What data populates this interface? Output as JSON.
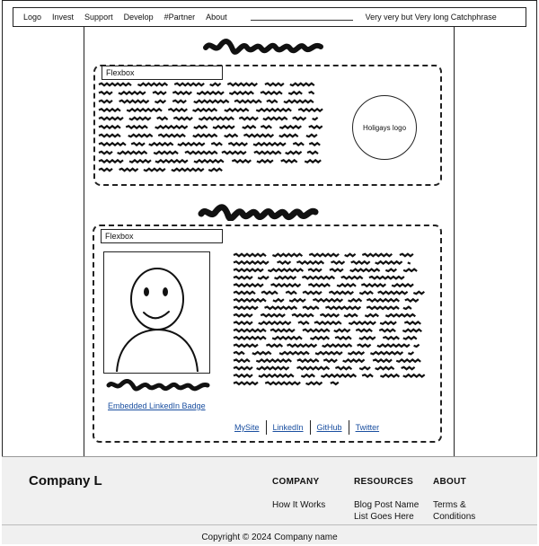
{
  "nav": {
    "items": [
      "Logo",
      "Invest",
      "Support",
      "Develop",
      "#Partner",
      "About"
    ],
    "catchphrase": "Very very but Very long Catchphrase"
  },
  "section1": {
    "label": "Flexbox",
    "logo_text": "Holigays logo"
  },
  "section2": {
    "label": "Flexbox",
    "linkedin_badge": "Embedded LinkedIn Badge",
    "links": [
      "MySite",
      "LinkedIn",
      "GitHub",
      "Twitter"
    ]
  },
  "footer": {
    "company": "Company L",
    "columns": [
      {
        "heading": "COMPANY",
        "items": [
          "How It Works"
        ]
      },
      {
        "heading": "RESOURCES",
        "items": [
          "Blog Post Name List Goes Here"
        ]
      },
      {
        "heading": "ABOUT",
        "items": [
          "Terms & Conditions"
        ]
      }
    ],
    "copyright": "Copyright © 2024 Company name"
  }
}
